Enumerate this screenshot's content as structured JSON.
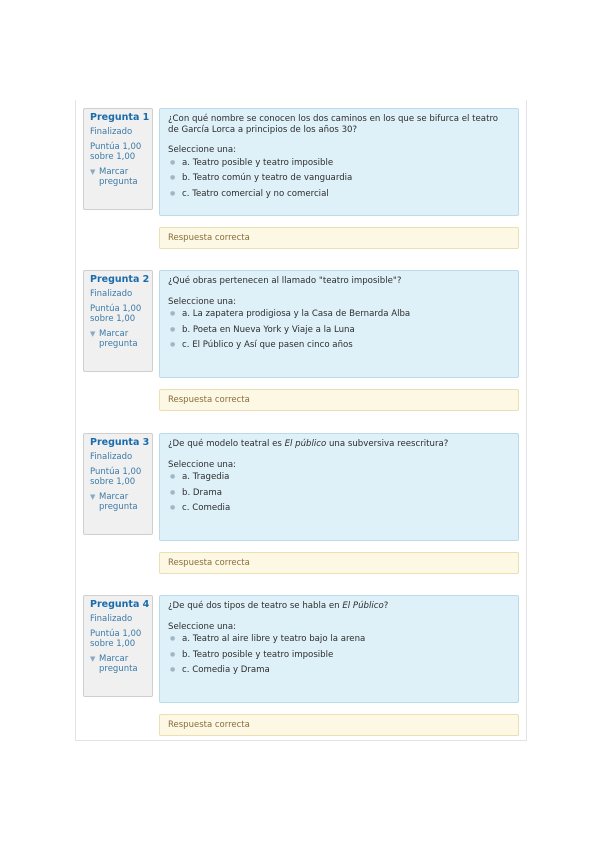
{
  "questions": [
    {
      "number": "Pregunta 1",
      "state": "Finalizado",
      "grade": "Puntúa 1,00 sobre 1,00",
      "flag_label": "Marcar pregunta",
      "text_before": "¿Con qué nombre se conocen los dos caminos en los que se bifurca el teatro de García Lorca a principios de los años 30?",
      "text_em": "",
      "text_after": "",
      "prompt": "Seleccione una:",
      "options": [
        "a. Teatro posible y teatro imposible",
        "b. Teatro común y teatro de vanguardia",
        "c. Teatro comercial y no comercial"
      ],
      "feedback": "Respuesta correcta"
    },
    {
      "number": "Pregunta 2",
      "state": "Finalizado",
      "grade": "Puntúa 1,00 sobre 1,00",
      "flag_label": "Marcar pregunta",
      "text_before": "¿Qué obras pertenecen al llamado \"teatro imposible\"?",
      "text_em": "",
      "text_after": "",
      "prompt": "Seleccione una:",
      "options": [
        "a. La zapatera prodigiosa y la Casa de Bernarda Alba",
        "b. Poeta en Nueva York y Viaje a la Luna",
        "c. El Público y Así que pasen cinco años"
      ],
      "feedback": "Respuesta correcta"
    },
    {
      "number": "Pregunta 3",
      "state": "Finalizado",
      "grade": "Puntúa 1,00 sobre 1,00",
      "flag_label": "Marcar pregunta",
      "text_before": "¿De qué modelo teatral es ",
      "text_em": "El público",
      "text_after": " una subversiva reescritura?",
      "prompt": "Seleccione una:",
      "options": [
        "a. Tragedia",
        "b. Drama",
        "c. Comedia"
      ],
      "feedback": "Respuesta correcta"
    },
    {
      "number": "Pregunta 4",
      "state": "Finalizado",
      "grade": "Puntúa 1,00 sobre 1,00",
      "flag_label": "Marcar pregunta",
      "text_before": "¿De qué dos tipos de teatro se habla en ",
      "text_em": "El Público",
      "text_after": "?",
      "prompt": "Seleccione una:",
      "options": [
        "a. Teatro al aire libre y teatro bajo la arena",
        "b. Teatro posible y teatro imposible",
        "c. Comedia y Drama"
      ],
      "feedback": "Respuesta correcta"
    }
  ]
}
